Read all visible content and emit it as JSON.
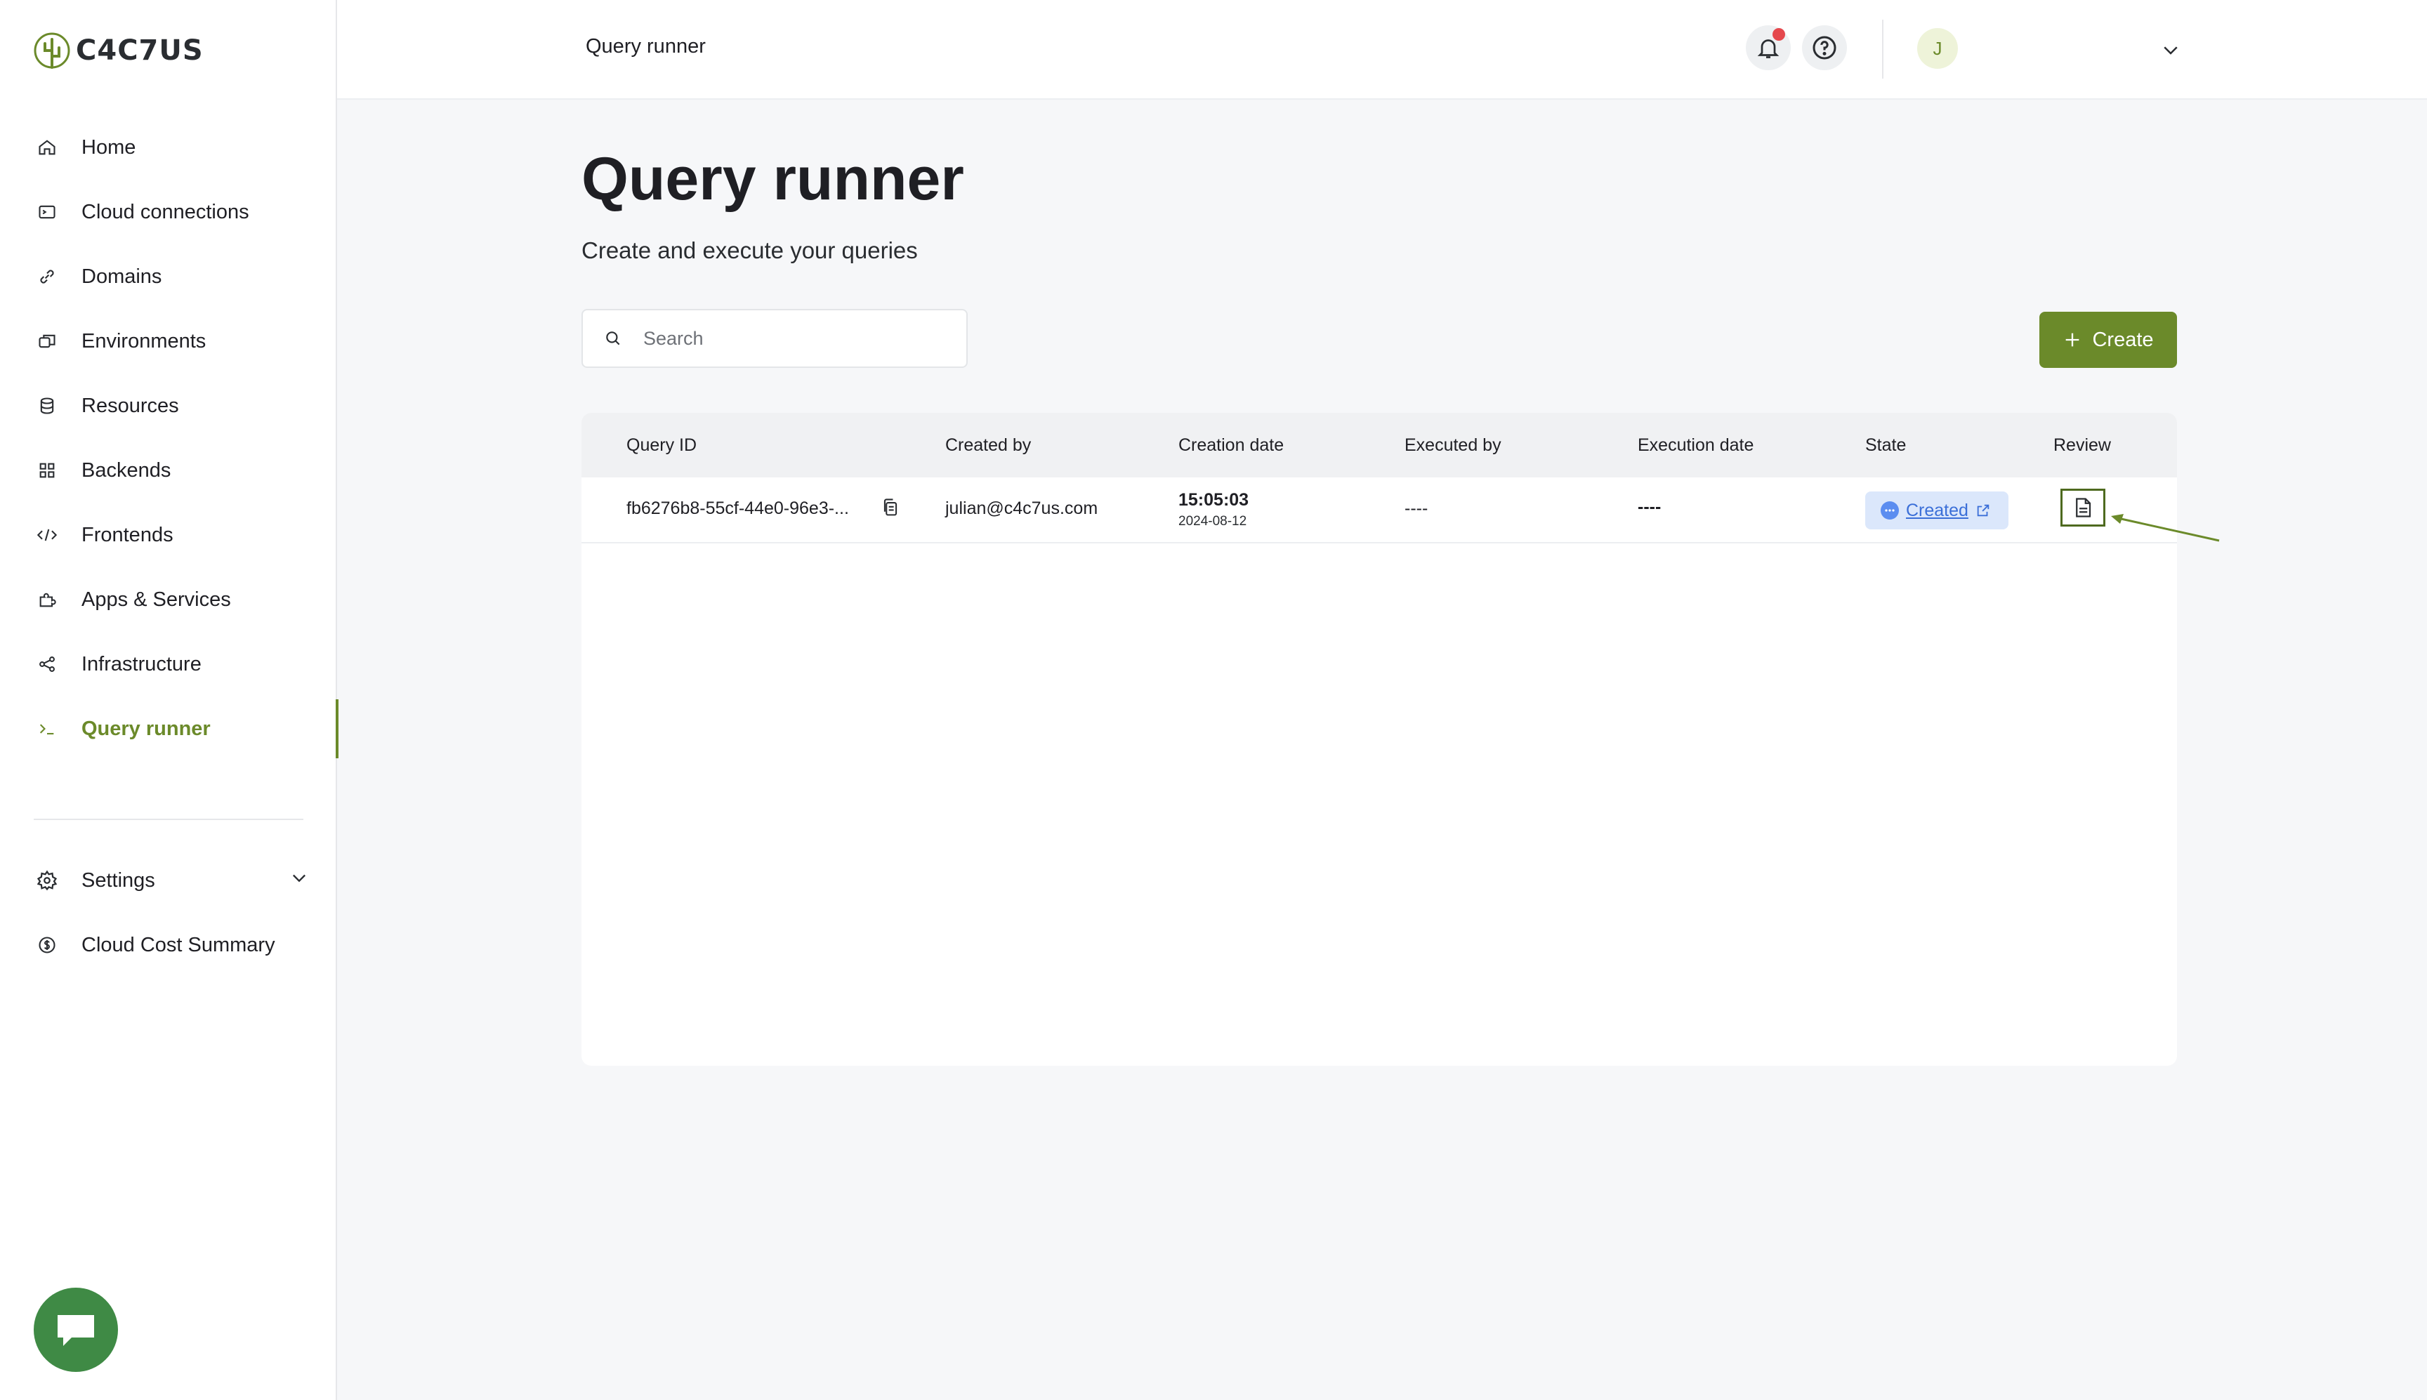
{
  "brand": {
    "logo_text": "C4C7US",
    "accent_color": "#6b8a2a"
  },
  "sidebar": {
    "items": [
      {
        "label": "Home",
        "icon": "home-icon"
      },
      {
        "label": "Cloud connections",
        "icon": "terminal-box-icon"
      },
      {
        "label": "Domains",
        "icon": "link-icon"
      },
      {
        "label": "Environments",
        "icon": "environments-icon"
      },
      {
        "label": "Resources",
        "icon": "database-icon"
      },
      {
        "label": "Backends",
        "icon": "grid-icon"
      },
      {
        "label": "Frontends",
        "icon": "code-icon"
      },
      {
        "label": "Apps & Services",
        "icon": "puzzle-icon"
      },
      {
        "label": "Infrastructure",
        "icon": "share-nodes-icon"
      },
      {
        "label": "Query runner",
        "icon": "prompt-icon",
        "active": true
      }
    ],
    "secondary": [
      {
        "label": "Settings",
        "icon": "gear-icon",
        "expandable": true
      },
      {
        "label": "Cloud Cost Summary",
        "icon": "dollar-circle-icon"
      }
    ]
  },
  "header": {
    "breadcrumb": "Query runner",
    "avatar_initial": "J"
  },
  "main": {
    "title": "Query runner",
    "subtitle": "Create and execute your queries",
    "search_placeholder": "Search",
    "create_label": "Create"
  },
  "table": {
    "columns": [
      "Query ID",
      "Created by",
      "Creation date",
      "Executed by",
      "Execution date",
      "State",
      "Review"
    ],
    "rows": [
      {
        "query_id": "fb6276b8-55cf-44e0-96e3-...",
        "created_by": "julian@c4c7us.com",
        "creation_time": "15:05:03",
        "creation_date": "2024-08-12",
        "executed_by": "----",
        "execution_date": "----",
        "state": "Created"
      }
    ]
  }
}
